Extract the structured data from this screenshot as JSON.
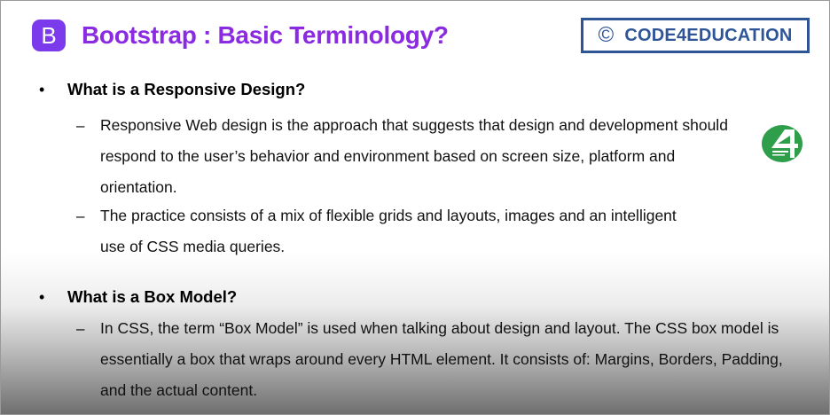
{
  "header": {
    "logo_letter": "B",
    "title": "Bootstrap : Basic Terminology?",
    "brand_symbol": "©",
    "brand_text": "CODE4EDUCATION"
  },
  "side_logo": {
    "icon": "code4education-logo-icon"
  },
  "sections": [
    {
      "bullet": "•",
      "heading": "What is a Responsive Design?",
      "items": [
        {
          "dash": "–",
          "text": "Responsive Web design is the approach that suggests that design and development should respond to the user’s behavior and environment based on screen size, platform and orientation."
        },
        {
          "dash": "–",
          "text": "The practice consists of a mix of flexible grids and layouts, images and an intelligent use of CSS media queries."
        }
      ]
    },
    {
      "bullet": "•",
      "heading": "What is a Box Model?",
      "items": [
        {
          "dash": "–",
          "text": "In CSS, the term “Box Model” is used when talking about design and layout. The CSS box model is essentially a box that wraps around every HTML element. It consists of: Margins, Borders, Padding, and the actual content."
        }
      ]
    }
  ],
  "colors": {
    "title": "#8a2be2",
    "logo_bg": "#7c3aed",
    "brand_text": "#2f5597",
    "brand_border": "#2f5597",
    "side_logo_green": "#2e9e4a"
  }
}
